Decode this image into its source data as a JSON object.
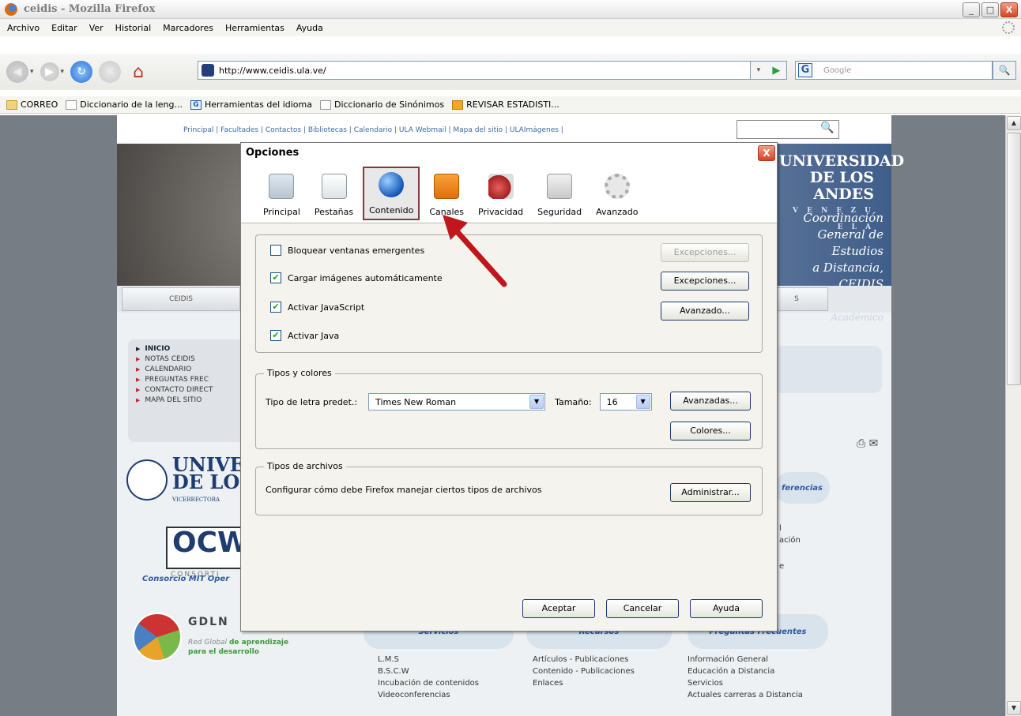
{
  "window": {
    "title": "ceidis - Mozilla Firefox",
    "min": "_",
    "max": "□",
    "close": "X"
  },
  "menu": [
    "Archivo",
    "Editar",
    "Ver",
    "Historial",
    "Marcadores",
    "Herramientas",
    "Ayuda"
  ],
  "nav": {
    "back": "◀",
    "forward": "▶",
    "reload": "↻",
    "stop": "✕",
    "home": "⌂",
    "drop": "▾"
  },
  "url": "http://www.ceidis.ula.ve/",
  "url_go": {
    "drop": "▾",
    "go": "▶"
  },
  "search": {
    "engine": "G",
    "placeholder": "Google",
    "go": "🔍"
  },
  "bookmarks": [
    {
      "label": "CORREO",
      "icon": "folder-icon"
    },
    {
      "label": "Diccionario de la leng...",
      "icon": "page-icon"
    },
    {
      "label": "Herramientas del idioma",
      "icon": "google-icon"
    },
    {
      "label": "Diccionario de Sinónimos",
      "icon": "page-icon"
    },
    {
      "label": "REVISAR ESTADISTI...",
      "icon": "stats-icon"
    }
  ],
  "site": {
    "toplinks": "Principal | Facultades | Contactos | Bibliotecas | Calendario | ULA Webmail | Mapa del sitio | ULAImágenes |",
    "search_go": "🔍",
    "university": [
      "UNIVERSIDAD",
      "DE LOS ANDES",
      "V E N E Z U E L A"
    ],
    "coordination": [
      "Coordinación General de Estudios",
      "a Distancia, CEIDIS",
      "Vicerrectorado Académico"
    ],
    "tabs": [
      "CEIDIS",
      "S"
    ],
    "leftmenu": [
      "INICIO",
      "NOTAS CEIDIS",
      "CALENDARIO",
      "PREGUNTAS FREC",
      "CONTACTO DIRECT",
      "MAPA DEL SITIO"
    ],
    "logo_uni": [
      "UNIVE",
      "DE LOS",
      "VICERRECTORA"
    ],
    "ocw": {
      "main": "OCW",
      "cons": "CONSORTI"
    },
    "mit": "Consorcio MIT Oper",
    "gdln": "GDLN",
    "red": [
      "Red Global",
      "de aprendizaje",
      "para el desarrollo"
    ],
    "pills": [
      "Servicios",
      "Recursos",
      "Preguntas Frecuentes",
      "ferencias"
    ],
    "col1": [
      "L.M.S",
      "B.S.C.W",
      "Incubación de contenidos",
      "Videoconferencias"
    ],
    "col2": [
      "Artículos - Publicaciones",
      "Contenido - Publicaciones",
      "Enlaces"
    ],
    "col3": [
      "Información General",
      "Educación a Distancia",
      "Servicios",
      "Actuales carreras a Distancia"
    ],
    "right_fragments": [
      "l",
      "ación",
      "e"
    ]
  },
  "dialog": {
    "title": "Opciones",
    "close": "X",
    "tabs": [
      "Principal",
      "Pestañas",
      "Contenido",
      "Canales",
      "Privacidad",
      "Seguridad",
      "Avanzado"
    ],
    "selected_tab": "Contenido",
    "checks": [
      {
        "label": "Bloquear ventanas emergentes",
        "checked": false,
        "mark": ""
      },
      {
        "label": "Cargar imágenes automáticamente",
        "checked": true,
        "mark": "✔"
      },
      {
        "label": "Activar JavaScript",
        "checked": true,
        "mark": "✔"
      },
      {
        "label": "Activar Java",
        "checked": true,
        "mark": "✔"
      }
    ],
    "btn_excepciones_dis": "Excepciones...",
    "btn_excepciones": "Excepciones...",
    "btn_avanzado": "Avanzado...",
    "fonts_group": "Tipos y colores",
    "font_label": "Tipo de letra predet.:",
    "font_value": "Times New Roman",
    "size_label": "Tamaño:",
    "size_value": "16",
    "btn_avanzadas": "Avanzadas...",
    "btn_colores": "Colores...",
    "files_group": "Tipos de archivos",
    "files_text": "Configurar cómo debe Firefox manejar ciertos tipos de archivos",
    "btn_administrar": "Administrar...",
    "btn_aceptar": "Aceptar",
    "btn_cancelar": "Cancelar",
    "btn_ayuda": "Ayuda"
  },
  "scroll": {
    "up": "▲",
    "down": "▼"
  },
  "colors": {
    "annotation_arrow": "#c0171d",
    "dialog_bg": "#f4f3ee",
    "page_bg": "#767d84"
  }
}
